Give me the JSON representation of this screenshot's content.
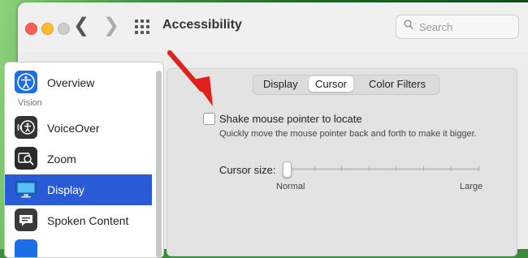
{
  "window": {
    "title": "Accessibility"
  },
  "search": {
    "placeholder": "Search"
  },
  "sidebar": {
    "section_vision": "Vision",
    "items": [
      {
        "label": "Overview",
        "icon": "accessibility-icon"
      },
      {
        "label": "VoiceOver",
        "icon": "voiceover-icon"
      },
      {
        "label": "Zoom",
        "icon": "zoom-icon"
      },
      {
        "label": "Display",
        "icon": "display-icon",
        "selected": true
      },
      {
        "label": "Spoken Content",
        "icon": "spoken-content-icon"
      }
    ]
  },
  "tabs": {
    "display": "Display",
    "cursor": "Cursor",
    "filters": "Color Filters",
    "selected": "Cursor"
  },
  "cursor_settings": {
    "shake_label": "Shake mouse pointer to locate",
    "shake_checked": false,
    "shake_desc": "Quickly move the mouse pointer back and forth to make it bigger.",
    "size_label": "Cursor size:",
    "size_min_label": "Normal",
    "size_max_label": "Large",
    "size_value": 0
  },
  "colors": {
    "accent": "#2a5bd7",
    "annotation_arrow": "#e0201a"
  }
}
